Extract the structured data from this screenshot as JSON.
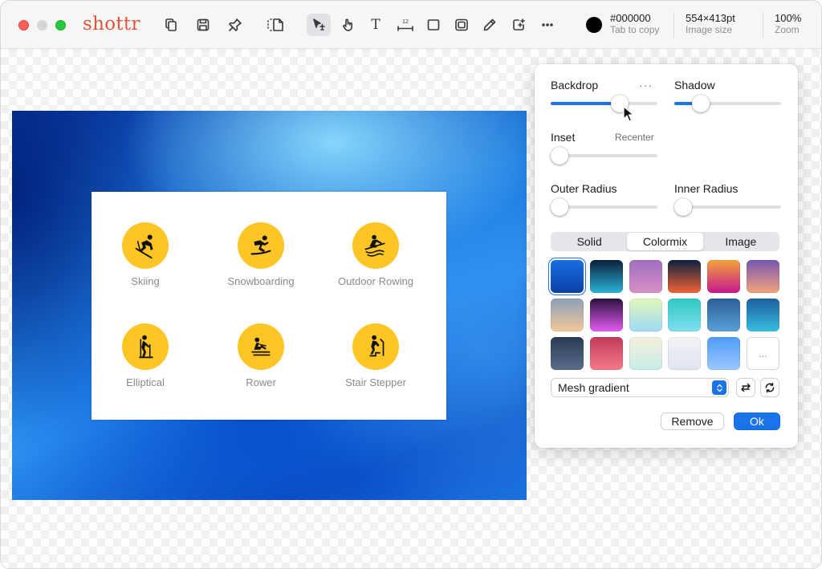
{
  "app": {
    "logo": "shottr",
    "window_buttons": [
      "close",
      "minimize",
      "zoom"
    ]
  },
  "toolbar": {
    "tools": [
      {
        "name": "copy-icon"
      },
      {
        "name": "save-icon"
      },
      {
        "name": "pin-icon"
      },
      {
        "name": "crop-expand-icon"
      },
      {
        "name": "select-arrow-icon",
        "active": true
      },
      {
        "name": "hand-pointer-icon"
      },
      {
        "name": "text-tool-icon"
      },
      {
        "name": "ruler-icon",
        "label": "12"
      },
      {
        "name": "rectangle-icon"
      },
      {
        "name": "blur-box-icon"
      },
      {
        "name": "pencil-icon"
      },
      {
        "name": "add-element-icon"
      },
      {
        "name": "more-icon"
      }
    ],
    "color_value": "#000000",
    "color_hint": "Tab to copy",
    "size_value": "554×413pt",
    "size_label": "Image size",
    "zoom_value": "100%",
    "zoom_label": "Zoom"
  },
  "canvas": {
    "activities": [
      {
        "name": "Skiing",
        "icon": "skiing-icon"
      },
      {
        "name": "Snowboarding",
        "icon": "snowboarding-icon"
      },
      {
        "name": "Outdoor Rowing",
        "icon": "outdoor-rowing-icon"
      },
      {
        "name": "Elliptical",
        "icon": "elliptical-icon"
      },
      {
        "name": "Rower",
        "icon": "rower-icon"
      },
      {
        "name": "Stair Stepper",
        "icon": "stair-stepper-icon"
      }
    ]
  },
  "panel": {
    "backdrop_label": "Backdrop",
    "more_label": "···",
    "shadow_label": "Shadow",
    "inset_label": "Inset",
    "recenter_label": "Recenter",
    "outer_radius_label": "Outer Radius",
    "inner_radius_label": "Inner Radius",
    "sliders": {
      "backdrop": 0.65,
      "shadow": 0.25,
      "inset": 0.08,
      "outer_radius": 0.08,
      "inner_radius": 0.08
    },
    "tabs": [
      "Solid",
      "Colormix",
      "Image"
    ],
    "selected_tab": "Colormix",
    "swatches": [
      [
        "#1a6fe0",
        "#0a3fa5"
      ],
      [
        "#0b1f3a",
        "#2bb3d6"
      ],
      [
        "#9f6fbf",
        "#d890c5"
      ],
      [
        "#0b2240",
        "#f26236"
      ],
      [
        "#f3a33a",
        "#c7178e"
      ],
      [
        "#7656b0",
        "#f3a27a"
      ],
      [
        "#8ea0b8",
        "#f3c89a"
      ],
      [
        "#2a1040",
        "#e45cf0"
      ],
      [
        "#dff7b8",
        "#9fd9f5"
      ],
      [
        "#2fc9c0",
        "#7fe0f0"
      ],
      [
        "#2b5e9a",
        "#5aa0d8"
      ],
      [
        "#1d5f9e",
        "#37bde0"
      ],
      [
        "#2a3a55",
        "#5a6e8a"
      ],
      [
        "#c23a5a",
        "#f57a8a"
      ],
      [
        "#f4f1dc",
        "#c8ece8"
      ],
      [
        "#f2f3f6",
        "#dfe4ee"
      ],
      [
        "#4f9bf5",
        "#9cc8ff"
      ]
    ],
    "more_swatches": "...",
    "gradient_mode": "Mesh gradient",
    "remove_label": "Remove",
    "ok_label": "Ok"
  }
}
